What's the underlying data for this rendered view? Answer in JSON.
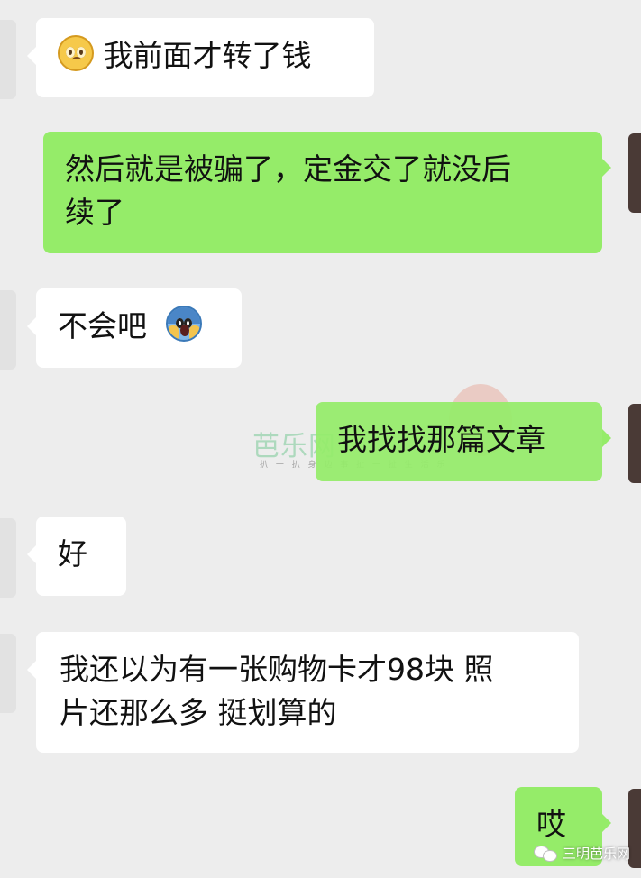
{
  "messages": [
    {
      "id": 1,
      "side": "in",
      "emoji": "pleading-face",
      "text": "我前面才转了钱"
    },
    {
      "id": 2,
      "side": "out",
      "line1": "然后就是被骗了，定金交了就没后",
      "line2": "续了"
    },
    {
      "id": 3,
      "side": "in",
      "text": "不会吧",
      "emoji": "screaming-face"
    },
    {
      "id": 4,
      "side": "out",
      "text": "我找找那篇文章"
    },
    {
      "id": 5,
      "side": "in",
      "text": "好"
    },
    {
      "id": 6,
      "side": "in",
      "line1": "我还以为有一张购物卡才98块 照",
      "line2": "片还那么多 挺划算的"
    },
    {
      "id": 7,
      "side": "out",
      "text": "哎"
    }
  ],
  "watermark": {
    "text": "芭乐网",
    "subtext": "扒 一 扒 身 边 事   扯 一 扯 生 活 乐"
  },
  "footer_watermark": {
    "icon": "wechat-icon",
    "text": "三明芭乐网"
  },
  "colors": {
    "background": "#ededed",
    "incoming_bubble": "#ffffff",
    "outgoing_bubble": "#95ec69"
  }
}
